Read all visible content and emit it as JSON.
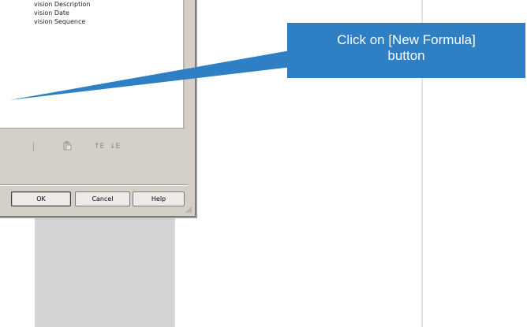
{
  "dialog": {
    "field_list": [
      "vision Description",
      "vision Date",
      "vision Sequence"
    ],
    "toolbar": {
      "paste_icon": "paste-icon",
      "move_up_glyph": "↑E",
      "move_down_glyph": "↓E"
    },
    "buttons": {
      "ok": "OK",
      "cancel": "Cancel",
      "help": "Help"
    }
  },
  "callout": {
    "line1": "Click on [New Formula]",
    "line2": "button",
    "color": "#2f7fc4"
  }
}
